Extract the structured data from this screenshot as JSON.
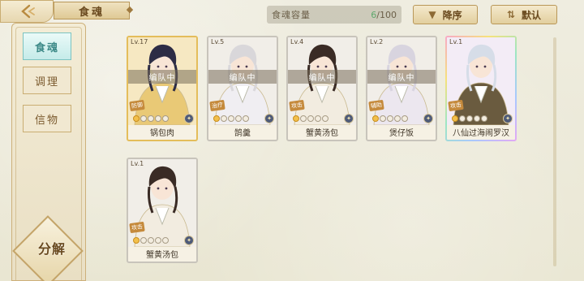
{
  "header": {
    "title": "食魂",
    "capacity_label": "食魂容量",
    "capacity_current": "6",
    "capacity_max": "/100",
    "sort_desc_label": "降序",
    "sort_default_label": "默认"
  },
  "sidebar": {
    "items": [
      {
        "label": "食魂",
        "active": true
      },
      {
        "label": "调理",
        "active": false
      },
      {
        "label": "信物",
        "active": false
      }
    ],
    "decompose_label": "分解"
  },
  "cards": [
    {
      "level": "Lv.17",
      "name": "锅包肉",
      "team": "编队中",
      "role": "防御",
      "rank_on": 1,
      "frame": "gold",
      "hair": "#2d2c45",
      "outfit": "#e9c976"
    },
    {
      "level": "Lv.5",
      "name": "鹄羹",
      "team": "编队中",
      "role": "治疗",
      "rank_on": 1,
      "frame": "silver",
      "hair": "#d9d7da",
      "outfit": "#f0eef2"
    },
    {
      "level": "Lv.4",
      "name": "蟹黄汤包",
      "team": "编队中",
      "role": "攻击",
      "rank_on": 1,
      "frame": "silver",
      "hair": "#3a2b25",
      "outfit": "#f2ece0"
    },
    {
      "level": "Lv.2",
      "name": "煲仔饭",
      "team": "编队中",
      "role": "辅助",
      "rank_on": 1,
      "frame": "silver",
      "hair": "#d8d4df",
      "outfit": "#ece7ef"
    },
    {
      "level": "Lv.1",
      "name": "八仙过海闹罗汉",
      "team": "",
      "role": "攻击",
      "rank_on": 1,
      "frame": "rainbow",
      "hair": "#d6dde8",
      "outfit": "#6a5b3f"
    },
    {
      "level": "Lv.1",
      "name": "蟹黄汤包",
      "team": "",
      "role": "攻击",
      "rank_on": 1,
      "frame": "silver",
      "hair": "#3a2b25",
      "outfit": "#f2ece0"
    }
  ],
  "icons": {
    "back": "back-arrow-icon",
    "sort_desc": "sort-desc-icon",
    "sort_default": "sort-default-icon",
    "type": "food-type-icon"
  },
  "colors": {
    "active_tab": "#7cc3c0",
    "gold_frame": "#e4bd5b",
    "capacity_current": "#5fa86c"
  }
}
